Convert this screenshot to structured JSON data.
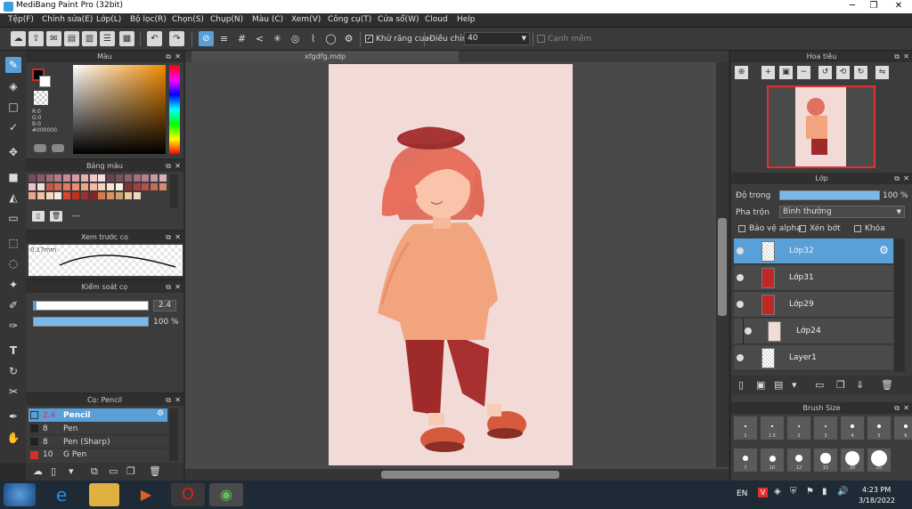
{
  "window": {
    "title": "MediBang Paint Pro (32bit)"
  },
  "menu": [
    "Tệp(F)",
    "Chỉnh sửa(E)",
    "Lớp(L)",
    "Bộ lọc(R)",
    "Chọn(S)",
    "Chụp(N)",
    "Màu (C)",
    "Xem(V)",
    "Công cụ(T)",
    "Cửa sổ(W)",
    "Cloud",
    "Help"
  ],
  "toolbar": {
    "antialias_label": "Khử răng cưa",
    "adjust_label": "Điều chỉnh",
    "adjust_value": "40",
    "edge_label": "Cạnh mềm"
  },
  "color_panel": {
    "title": "Màu",
    "r": "R:0",
    "g": "G:0",
    "b": "B:0",
    "hex": "#000000",
    "main_color": "#000000"
  },
  "palette_panel": {
    "title": "Bảng màu",
    "extra": "---",
    "swatches": [
      "#7b4a5a",
      "#8a5a6a",
      "#a06a78",
      "#b57a88",
      "#c98a95",
      "#d99aa5",
      "#e6b0b8",
      "#f0c8cc",
      "#f8dde0",
      "#6a4050",
      "#7a5060",
      "#8f6070",
      "#a27080",
      "#b88090",
      "#c99aa5",
      "#d8b0b8",
      "#e6c4c8",
      "#f4dcdc",
      "#c25a4a",
      "#d06a55",
      "#dd7a60",
      "#e89070",
      "#f0a585",
      "#f5bba0",
      "#f8cfb8",
      "#fbe0d0",
      "#fff0e6",
      "#8a3030",
      "#a04040",
      "#b85050",
      "#c86a55",
      "#d88a70",
      "#e5a58a",
      "#eebfa5",
      "#f5d5c0",
      "#faeadc",
      "#e04030",
      "#c03020",
      "#a03030",
      "#802828",
      "#d87a50",
      "#e0905a",
      "#d0a070",
      "#e8c8a0",
      "#f0d8b8"
    ]
  },
  "preview_panel": {
    "title": "Xem trước cọ",
    "size": "0.17mm"
  },
  "brush_control": {
    "title": "Kiểm soát cọ",
    "size": "2.4",
    "opacity": "100 %",
    "size_frac": 0.02,
    "opacity_frac": 1.0
  },
  "brush_panel": {
    "title": "Cọ: Pencil",
    "items": [
      {
        "size": "2.4",
        "name": "Pencil",
        "color": "#222222"
      },
      {
        "size": "8",
        "name": "Pen",
        "color": "#222222"
      },
      {
        "size": "8",
        "name": "Pen (Sharp)",
        "color": "#222222"
      },
      {
        "size": "10",
        "name": "G Pen",
        "color": "#d03030"
      }
    ]
  },
  "document": {
    "tab": "xfgdfg.mdp"
  },
  "navigator": {
    "title": "Hoa tiêu"
  },
  "layer_panel": {
    "title": "Lớp",
    "opacity_label": "Độ trong",
    "opacity_value": "100 %",
    "opacity_frac": 1.0,
    "blend_label": "Pha trộn",
    "blend_value": "Bình thường",
    "protect_alpha": "Bảo vệ alpha",
    "clip": "Xén bớt",
    "lock": "Khóa",
    "layers": [
      {
        "name": "Lớp32",
        "selected": true,
        "thumb": "#eeeeee"
      },
      {
        "name": "Lớp31",
        "selected": false,
        "thumb": "#c02828"
      },
      {
        "name": "Lớp29",
        "selected": false,
        "thumb": "#c02828"
      },
      {
        "name": "Lớp24",
        "selected": false,
        "thumb": "#f2dad6"
      },
      {
        "name": "Layer1",
        "selected": false,
        "thumb": "#eeeeee"
      }
    ]
  },
  "brush_size_panel": {
    "title": "Brush Size",
    "row1": [
      "1",
      "1.5",
      "2",
      "3",
      "4",
      "5",
      "6"
    ],
    "row2": [
      "7",
      "10",
      "12",
      "15",
      "20",
      "25"
    ]
  },
  "taskbar": {
    "lang": "EN",
    "time": "4:23 PM",
    "date": "3/18/2022"
  }
}
